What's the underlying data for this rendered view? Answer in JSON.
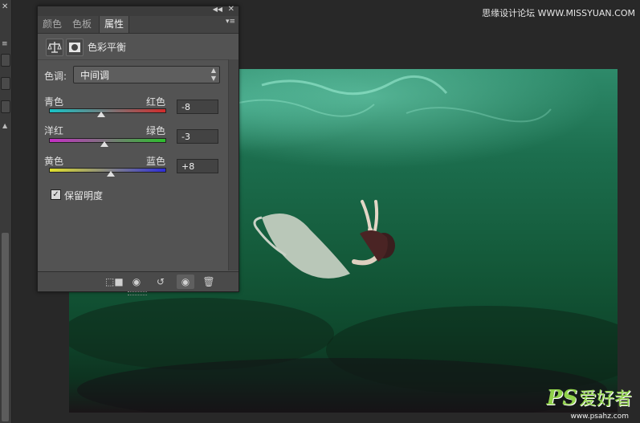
{
  "panel": {
    "tabs": [
      {
        "label": "颜色"
      },
      {
        "label": "色板"
      },
      {
        "label": "属性"
      }
    ],
    "title": "色彩平衡",
    "tone": {
      "label": "色调:",
      "value": "中间调"
    },
    "sliders": [
      {
        "left": "青色",
        "right": "红色",
        "value": "-8"
      },
      {
        "left": "洋红",
        "right": "绿色",
        "value": "-3"
      },
      {
        "left": "黄色",
        "right": "蓝色",
        "value": "+8"
      }
    ],
    "preserve_luminosity": {
      "label": "保留明度",
      "checked": true
    }
  },
  "watermark": {
    "top": "思缘设计论坛 WWW.MISSYUAN.COM",
    "logo_ps": "PS",
    "logo_cn": "爱好者",
    "url": "www.psahz.com"
  },
  "colors": {
    "panel_bg": "#535353",
    "workspace_bg": "#282828",
    "logo_green": "#8fd04a"
  },
  "icons": {
    "balance": "balance-scale-icon",
    "mask": "layer-mask-icon",
    "clip": "clip-to-layer-icon",
    "view_previous": "view-previous-state-icon",
    "reset": "reset-icon",
    "visibility": "eye-icon",
    "delete": "trash-icon"
  }
}
